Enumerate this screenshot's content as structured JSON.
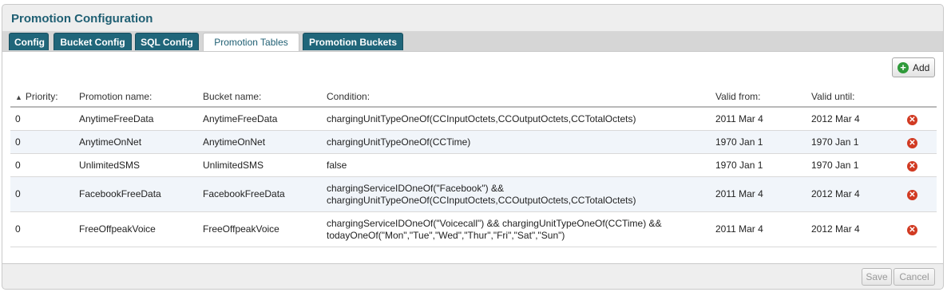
{
  "title": "Promotion Configuration",
  "tabs": [
    {
      "label": "Config"
    },
    {
      "label": "Bucket Config"
    },
    {
      "label": "SQL Config"
    },
    {
      "label": "Promotion Tables"
    },
    {
      "label": "Promotion Buckets"
    }
  ],
  "active_tab": "Promotion Tables",
  "toolbar": {
    "add_label": "Add"
  },
  "table": {
    "headers": [
      "Priority:",
      "Promotion name:",
      "Bucket name:",
      "Condition:",
      "Valid from:",
      "Valid until:"
    ],
    "sort_column": "Priority:",
    "sort_direction": "ascending",
    "rows": [
      {
        "priority": "0",
        "promotion": "AnytimeFreeData",
        "bucket": "AnytimeFreeData",
        "condition": [
          "chargingUnitTypeOneOf(CCInputOctets,CCOutputOctets,CCTotalOctets)"
        ],
        "valid_from": "2011 Mar 4",
        "valid_until": "2012 Mar 4"
      },
      {
        "priority": "0",
        "promotion": "AnytimeOnNet",
        "bucket": "AnytimeOnNet",
        "condition": [
          "chargingUnitTypeOneOf(CCTime)"
        ],
        "valid_from": "1970 Jan 1",
        "valid_until": "1970 Jan 1"
      },
      {
        "priority": "0",
        "promotion": "UnlimitedSMS",
        "bucket": "UnlimitedSMS",
        "condition": [
          "false"
        ],
        "valid_from": "1970 Jan 1",
        "valid_until": "1970 Jan 1"
      },
      {
        "priority": "0",
        "promotion": "FacebookFreeData",
        "bucket": "FacebookFreeData",
        "condition": [
          "chargingServiceIDOneOf(\"Facebook\") &&",
          "chargingUnitTypeOneOf(CCInputOctets,CCOutputOctets,CCTotalOctets)"
        ],
        "valid_from": "2011 Mar 4",
        "valid_until": "2012 Mar 4"
      },
      {
        "priority": "0",
        "promotion": "FreeOffpeakVoice",
        "bucket": "FreeOffpeakVoice",
        "condition": [
          "chargingServiceIDOneOf(\"Voicecall\") && chargingUnitTypeOneOf(CCTime) &&",
          "todayOneOf(\"Mon\",\"Tue\",\"Wed\",\"Thur\",\"Fri\",\"Sat\",\"Sun\")"
        ],
        "valid_from": "2011 Mar 4",
        "valid_until": "2012 Mar 4"
      }
    ]
  },
  "footer": {
    "save_label": "Save",
    "cancel_label": "Cancel"
  }
}
